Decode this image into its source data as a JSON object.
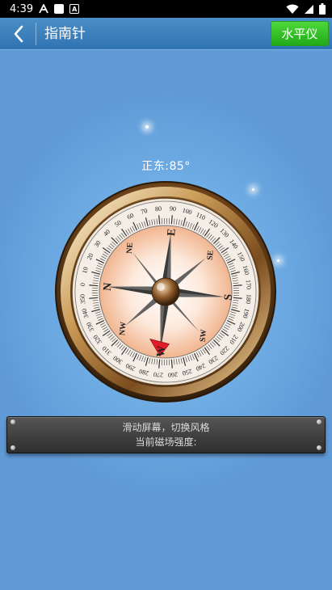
{
  "status_bar": {
    "time": "4:39"
  },
  "toolbar": {
    "title": "指南针",
    "level_button": "水平仪"
  },
  "main": {
    "heading_readout": "正东:85°",
    "info_line1": "滑动屏幕，切换风格",
    "info_line2": "当前磁场强度:"
  },
  "compass": {
    "cardinal": {
      "n": "N",
      "e": "E",
      "s": "S",
      "w": "W"
    },
    "intercardinal": {
      "ne": "NE",
      "se": "SE",
      "sw": "SW",
      "nw": "NW"
    },
    "degree_labels": [
      "0",
      "10",
      "20",
      "30",
      "40",
      "50",
      "60",
      "70",
      "80",
      "90",
      "100",
      "110",
      "120",
      "130",
      "140",
      "150",
      "160",
      "170",
      "180",
      "190",
      "200",
      "210",
      "220",
      "230",
      "240",
      "250",
      "260",
      "270",
      "280",
      "290",
      "300",
      "310",
      "320",
      "330",
      "340",
      "350"
    ],
    "rotation_deg": -85
  },
  "colors": {
    "toolbar": "#3a80bf",
    "level_button": "#34c326",
    "north_marker": "#e11d2a"
  }
}
